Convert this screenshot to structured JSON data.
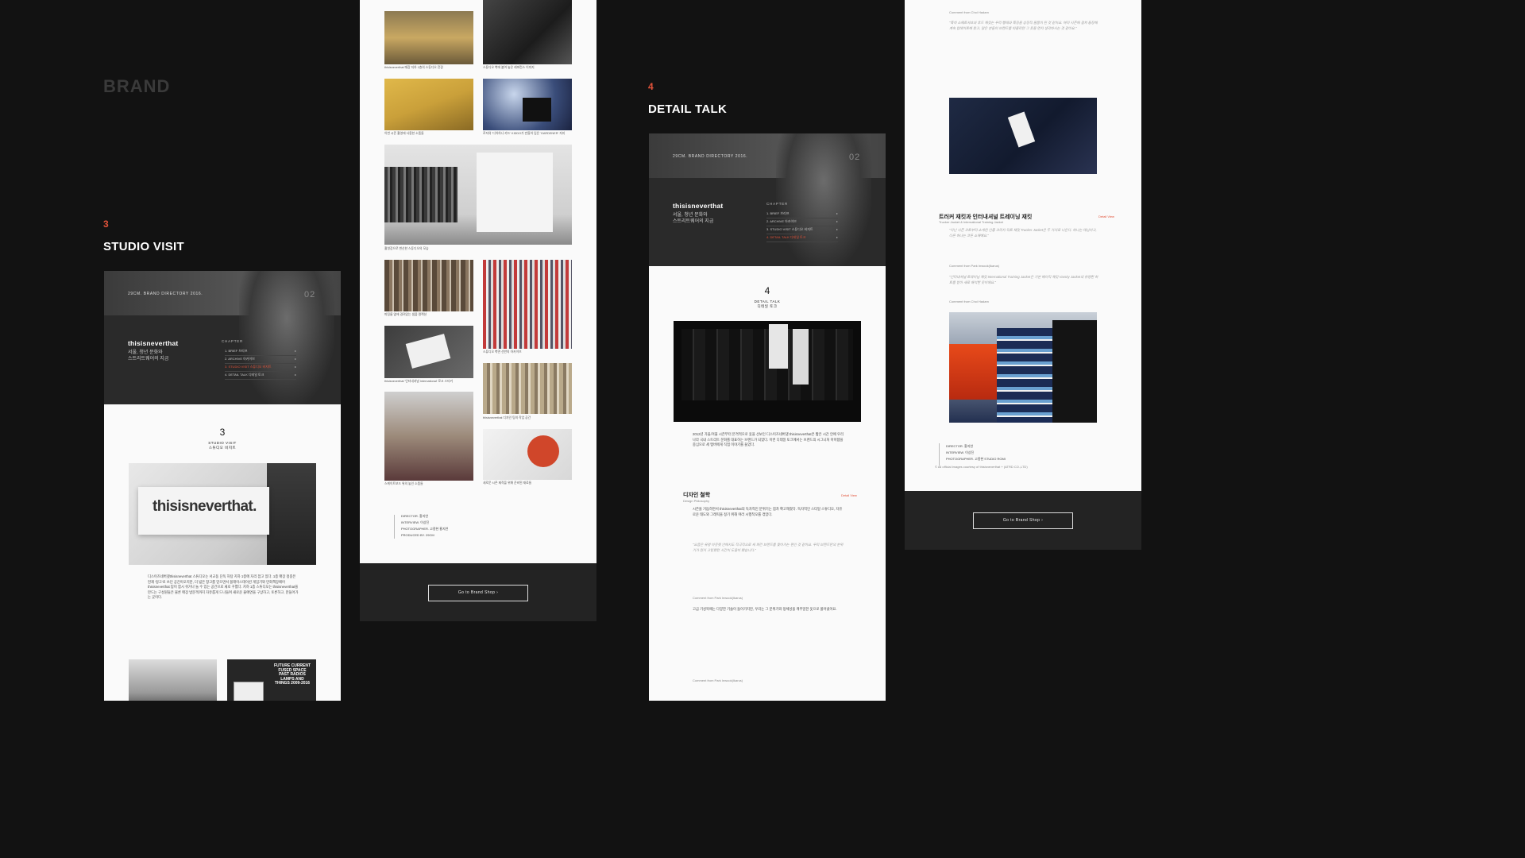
{
  "brand_heading": "BRAND",
  "sections": {
    "studio": {
      "number": "3",
      "title": "STUDIO VISIT"
    },
    "detail": {
      "number": "4",
      "title": "DETAIL TALK"
    }
  },
  "hero": {
    "tag": "29CM. BRAND DIRECTORY 2016.",
    "issue": "02",
    "brand": "thisisneverthat",
    "sub_line1": "서울, 청년 문화와",
    "sub_line2": "스트리트웨어의 지금",
    "chapter_label": "CHAPTER",
    "chapters": [
      "1. BRIEF 브리프",
      "2. ARCHIVE 아카이브",
      "3. STUDIO VISIT 스튜디오 비지트",
      "4. DETAIL TALK 디테일 토크"
    ]
  },
  "studio_page": {
    "number": "3",
    "label_en": "STUDIO VISIT",
    "label_ko": "스튜디오 비지트",
    "sign_text": "thisisneverthat.",
    "poster_text": "FUTURE CURRENT FUSED SPACE PAST RADIOS LAMPS AND THINGS 2009-2016",
    "body": "디스이즈네버댓thisisneverthat 스튜디오는 서교동 단독 하탕 지하 1층에 자리 잡고 있다. 1층 매장 정중은 현재 '정고'로 쓰던 공간이오지만, 더 넓은 창고를 얻으면서 블래이스테이션 게임기와 만화책장페어thisisneverthat 탐이 함시 쉬거나 놀 수 있는 공간으로 새로 꾸몄다. 지하 1층 스튜디오는 thisisneverthat을 만드는 구성원들은 물론 매장 방문객까지 자유롭게 드나들며 새로운 물에면을 구상하고, 토론하고, 만들어가는 곳이다."
  },
  "gallery_page": {
    "captions": [
      "thisisneverthat 매장 지하 1층의 스튜디오 전경",
      "스튜디오 벽에 붙여 놓은 레퍼런스 이미지",
      "이번 시즌 촬영에 사용한 소품들",
      "로저의 '디어하나 카드' KIDDO가 만들어 입은 'GARDENER' 저지",
      "촬영장으로 변신한 스튜디오의 모습",
      "피팅룸 옆에 걸려있는 샘플 컬렉션",
      "thisisneverthat '인터내셔널 International' 로고 스티커",
      "스튜디오 벽면 선반의 아카이브",
      "thisisneverthat 디자인 팀의 작업 공간",
      "스케이트보드 위의 놓인 소품들",
      "새로운 시즌 제작을 위해 준비된 재료들"
    ],
    "credits": [
      "DIRECTOR. 홍지연",
      "INTERVIEW. 이상진",
      "PHOTOGRAPHER. 고종현 홍지연",
      "PRODUCED BY. 29CM"
    ],
    "shop_button": "Go to Brand Shop  ›"
  },
  "detail_page": {
    "number": "4",
    "label_en": "DETAIL TALK",
    "label_ko": "디테일 토크",
    "intro": "2012년 가을/겨울 시즌부터 본격적으로 옷을 선보인 디스이즈네버댓 thisisneverthat은 짧은 시간 안에 우리나라 국내 스트리트 문화를 대표하는 브랜드가 되었다. 이번 디테일 토크에서는 브랜드의 시그니처 아이템을 중심으로 세 멤버에게 직접 이야기를 들었다.",
    "heading": "디자인 철학",
    "heading_en": "Design Philosophy",
    "detail_link": "Detail View",
    "paragraphs": [
      "시즌을 거듭하면서 thisisneverthat의 독자적인 분위기는 점차 확고해졌다. 독자적인 스타일 스튜디오, 자유로운 태도와 그래픽을 정기 위해 여러 시행착오를 겪었다.",
      "\"요즘은 유명 아웃렛 안에서도 적극적으로 새 퍼런 브랜드를 찾아가는 편인 것 같아요. 우리 브랜드만의 분위기가 뭔지 고민했던 시간이 도움이 됐습니다.\"",
      "고급 기성복에는 다양한 기술이 들어가지만, 우리는 그 분위기와 정체성을 캐주얼한 옷으로 풀어냈어요."
    ],
    "comments": [
      "Comment from Park Inwook(Ikarus)",
      "Comment from Park Inwook(Ikarus)"
    ]
  },
  "right_page": {
    "comment_top": "Comment from Choi Hadam",
    "top_para": "\"특히 스웨트셔츠와 후드 재킷는 우리 행태와 특징을 상징적 물품이 된 것 같아요. 여러 시즌에 걸쳐 등장해 계속 업데이트해 왔고, 많은 분들이 브랜드를 떠올리면 그 옷을 먼저 생각하시는 것 같아요.\"",
    "heading": "트러커 재킷과 인터내셔널 트레이닝 재킷",
    "heading_en": "Trucker Jacket & International Training Jacket",
    "detail_link": "Detail View",
    "para1": "\"지난 시즌 코트부터 소개된 인증 크리치 덕트 재킷 Trucker Jacket은 두 가지로 나온다. 하나는 데님이고, 다른 하나는 코튼 소재예요.\"",
    "para2": "\"인터내셔널 트레이닝 재킷 International Training Jacket은 기본 베이직 재킷 Varsity Jacket의 유명한 하트를 받아 새로 해석한 옷이에요.\"",
    "comment_mid": "Comment from Park Inwook(Ikarus)",
    "comment_low": "Comment from Choi Hadam",
    "credits": [
      "DIRECTOR. 홍지연",
      "INTERVIEW. 이상진",
      "PHOTOGRAPHER. 고종현 STUDIO ROMI"
    ],
    "copyright": "© All official images courtesy of thisisneverthat + (ATRD CO.,LTD)",
    "shop_button": "Go to Brand Shop  ›"
  }
}
